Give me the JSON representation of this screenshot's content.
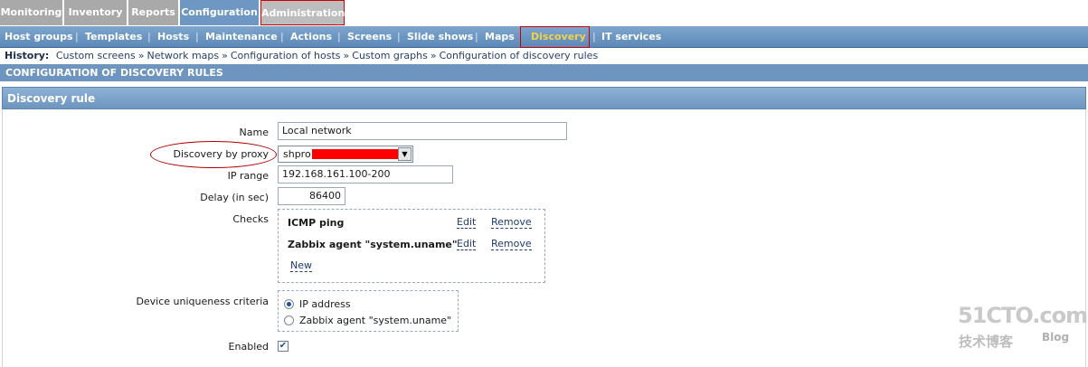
{
  "top_menu": {
    "monitoring": "Monitoring",
    "inventory": "Inventory",
    "reports": "Reports",
    "configuration": "Configuration",
    "administration": "Administration"
  },
  "sub_menu": {
    "host_groups": "Host groups",
    "templates": "Templates",
    "hosts": "Hosts",
    "maintenance": "Maintenance",
    "actions": "Actions",
    "screens": "Screens",
    "slide_shows": "Slide shows",
    "maps": "Maps",
    "discovery": "Discovery",
    "it_services": "IT services",
    "separator": "|"
  },
  "history": {
    "label": "History:",
    "separator": "»",
    "items": [
      "Custom screens",
      "Network maps",
      "Configuration of hosts",
      "Custom graphs",
      "Configuration of discovery rules"
    ]
  },
  "page_header": "CONFIGURATION OF DISCOVERY RULES",
  "form": {
    "title": "Discovery rule",
    "name_label": "Name",
    "name_value": "Local network",
    "proxy_label": "Discovery by proxy",
    "proxy_value": "shpro",
    "ip_range_label": "IP range",
    "ip_range_value": "192.168.161.100-200",
    "delay_label": "Delay (in sec)",
    "delay_value": "86400",
    "checks_label": "Checks",
    "checks": [
      {
        "name": "ICMP ping",
        "edit": "Edit",
        "remove": "Remove"
      },
      {
        "name": "Zabbix agent \"system.uname\"",
        "edit": "Edit",
        "remove": "Remove"
      }
    ],
    "new_check": "New",
    "criteria_label": "Device uniqueness criteria",
    "criteria_options": [
      "IP address",
      "Zabbix agent \"system.uname\""
    ],
    "criteria_selected": "IP address",
    "enabled_label": "Enabled",
    "enabled": true
  },
  "watermark": {
    "main": "51CTO.com",
    "sub": "技术博客",
    "blog": "Blog"
  },
  "colors": {
    "menu_active": "#6e98c3",
    "menu_inactive": "#a9a9a9",
    "submenu_active_text": "#f2d24a",
    "highlight_red": "#cc0000"
  }
}
